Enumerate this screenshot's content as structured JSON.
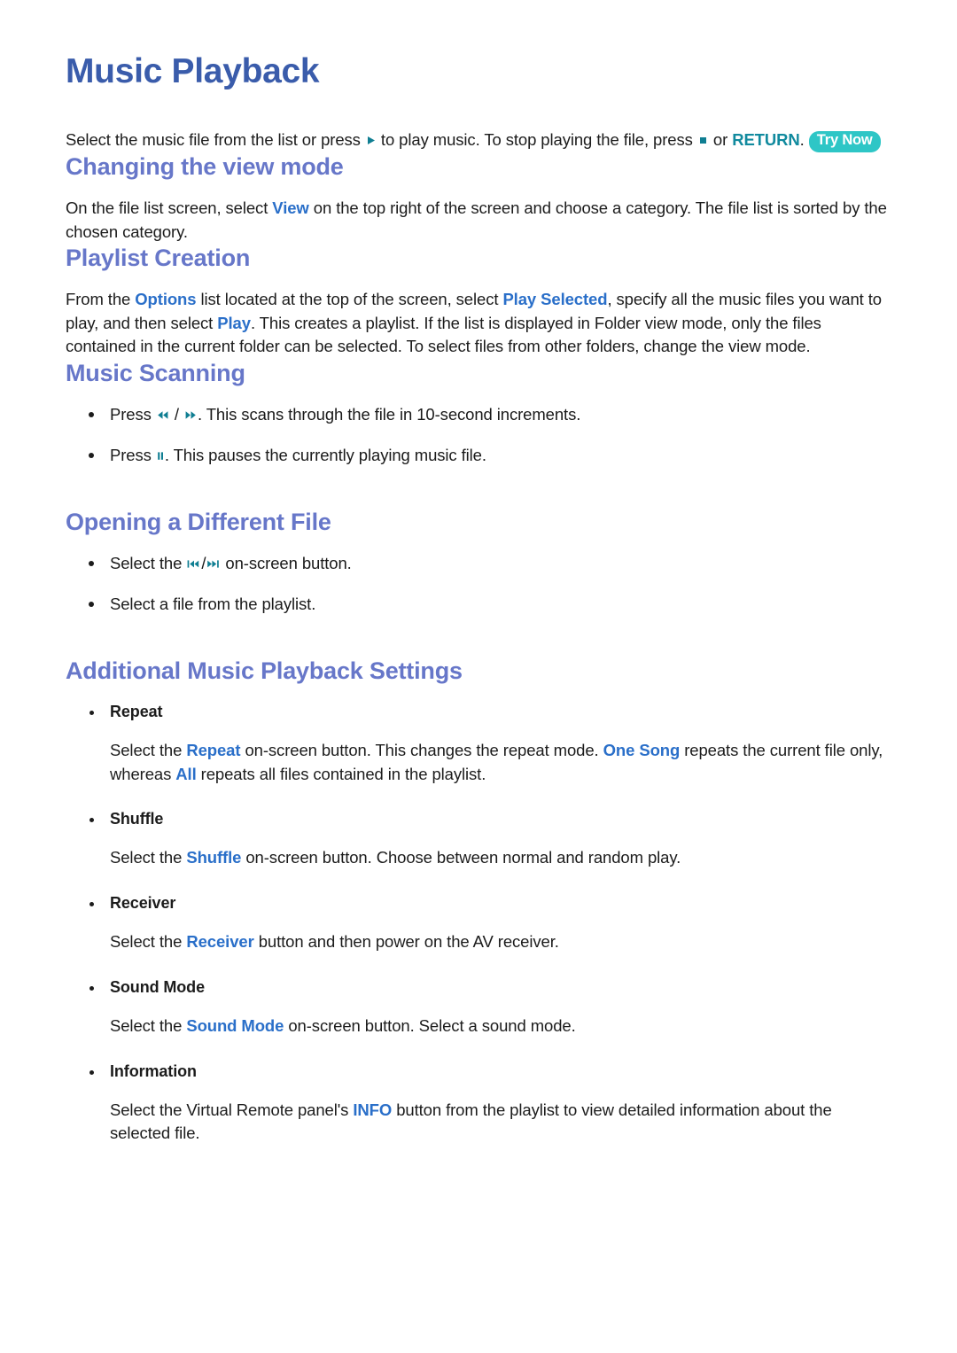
{
  "page": {
    "title": "Music Playback",
    "intro": {
      "part1": "Select the music file from the list or press ",
      "play_icon": "play-icon",
      "part2": " to play music. To stop playing the file, press ",
      "stop_icon": "stop-icon",
      "part3": " or ",
      "return_key": "RETURN",
      "part4": ". ",
      "try_now_badge": "Try Now"
    },
    "sections": [
      {
        "id": "changing-the-view-mode",
        "heading": "Changing the view mode",
        "paragraph": {
          "part1": "On the file list screen, select ",
          "kw1": "View",
          "part2": " on the top right of the screen and choose a category. The file list is sorted by the chosen category."
        }
      },
      {
        "id": "playlist-creation",
        "heading": "Playlist Creation",
        "paragraph": {
          "part1": "From the ",
          "kw1": "Options",
          "part2": " list located at the top of the screen, select ",
          "kw2": "Play Selected",
          "part3": ", specify all the music files you want to play, and then select ",
          "kw3": "Play",
          "part4": ". This creates a playlist. If the list is displayed in Folder view mode, only the files contained in the current folder can be selected. To select files from other folders, change the view mode."
        }
      },
      {
        "id": "music-scanning",
        "heading": "Music Scanning",
        "bullets": [
          {
            "part1": "Press ",
            "icon1": "rewind-icon",
            "sep": " / ",
            "icon2": "fast-forward-icon",
            "part2": ". This scans through the file in 10-second increments."
          },
          {
            "part1": "Press ",
            "icon1": "pause-icon",
            "part2": ". This pauses the currently playing music file."
          }
        ]
      },
      {
        "id": "opening-a-different-file",
        "heading": "Opening a Different File",
        "bullets": [
          {
            "part1": "Select the ",
            "icon1": "skip-previous-icon",
            "sep": "/",
            "icon2": "skip-next-icon",
            "part2": " on-screen button."
          },
          {
            "part1": "Select a file from the playlist."
          }
        ]
      },
      {
        "id": "additional-music-playback-settings",
        "heading": "Additional Music Playback Settings",
        "settings": [
          {
            "label": "Repeat",
            "desc": {
              "part1": "Select the ",
              "kw1": "Repeat",
              "part2": " on-screen button. This changes the repeat mode. ",
              "kw2": "One Song",
              "part3": " repeats the current file only, whereas ",
              "kw3": "All",
              "part4": " repeats all files contained in the playlist."
            }
          },
          {
            "label": "Shuffle",
            "desc": {
              "part1": "Select the ",
              "kw1": "Shuffle",
              "part2": " on-screen button. Choose between normal and random play."
            }
          },
          {
            "label": "Receiver",
            "desc": {
              "part1": "Select the ",
              "kw1": "Receiver",
              "part2": " button and then power on the AV receiver."
            }
          },
          {
            "label": "Sound Mode",
            "desc": {
              "part1": "Select the ",
              "kw1": "Sound Mode",
              "part2": " on-screen button. Select a sound mode."
            }
          },
          {
            "label": "Information",
            "desc": {
              "part1": "Select the Virtual Remote panel's ",
              "kw1": "INFO",
              "part2": " button from the playlist to view detailed information about the selected file."
            }
          }
        ]
      }
    ]
  },
  "colors": {
    "title_blue": "#3a5cab",
    "heading_blue": "#6777c9",
    "keyword_blue": "#2a6fc9",
    "keyword_teal": "#118a9e",
    "badge_teal": "#2ec6c6",
    "body_text": "#1c1c1c"
  }
}
